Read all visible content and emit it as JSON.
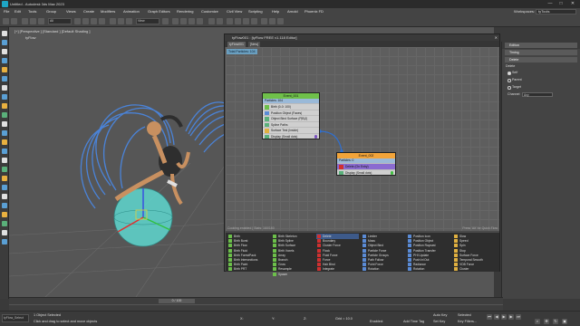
{
  "window": {
    "title": "Untitled - Autodesk 3ds Max 2023",
    "controls": [
      "—",
      "□",
      "✕"
    ]
  },
  "menu": {
    "items": [
      "File",
      "Edit",
      "Tools",
      "Group",
      "Views",
      "Create",
      "Modifiers",
      "Animation",
      "Graph Editors",
      "Rendering",
      "Customize",
      "Civil View",
      "Scripting",
      "Help",
      "Arnold",
      "Phoenix FD"
    ],
    "workspace_label": "Workspaces:",
    "workspace_value": "tyTools"
  },
  "toolbar": {
    "selection_set": "All",
    "view_select": "View"
  },
  "viewport": {
    "label": "[+] [Perspective ] [Standard ] [Default Shading ]",
    "sub_label": "tyFlow"
  },
  "editor": {
    "title": "tyFlow001 : [tyFlow FREE v1.118 Editor]",
    "tabs": [
      "tyFlow001",
      "[New]"
    ],
    "total_particles": "Total Particles: 104",
    "status_left": "Cooking enabled | Stats: 160/160",
    "status_right": "Press 'Alt' for Quick Flow",
    "event1": {
      "name": "Event_001",
      "particles": "Particles: 104",
      "operators": [
        {
          "label": "Birth (0-0: 100)",
          "icon_color": "#6cc04a"
        },
        {
          "label": "Position Object (Faces)",
          "icon_color": "#5a8bd6"
        },
        {
          "label": "Object Bind Surface (P|B|J)",
          "icon_color": "#5ab07a"
        },
        {
          "label": "Spline Paths",
          "icon_color": "#5ab07a"
        },
        {
          "label": "Surface Test (Inside)",
          "icon_color": "#e0b040"
        },
        {
          "label": "Display (Small dots)",
          "icon_color": "#5ab07a"
        }
      ]
    },
    "event2": {
      "name": "Event_002",
      "particles": "Particles: 0",
      "operators": [
        {
          "label": "Delete (On Entry)",
          "icon_color": "#d03030"
        },
        {
          "label": "Display (Small dots)",
          "icon_color": "#5ab07a"
        }
      ]
    },
    "operator_list": {
      "col1": [
        "Birth",
        "Birth Burst",
        "Birth Flow",
        "Birth Fluid",
        "Birth ForestPack",
        "Birth Intersections",
        "Birth Paint",
        "Birth PRT"
      ],
      "col2": [
        "Birth Skeleton",
        "Birth Spline",
        "Birth Surface",
        "Birth Voxels",
        "Array",
        "Branch",
        "Grow",
        "Resample",
        "Spawn"
      ],
      "col3": [
        "Delete",
        "Boundary",
        "Cluster Force",
        "Flock",
        "Fluid Force",
        "Force",
        "Hair Bind",
        "Integrate"
      ],
      "col4": [
        "Limiter",
        "Mass",
        "Object Bind",
        "Particle Force",
        "Particle Groups",
        "Path Follow",
        "Point Force",
        "Rotation"
      ],
      "col5": [
        "Position Icon",
        "Position Object",
        "Position Raycast",
        "Position Transfer",
        "PHI Update",
        "Push In/Out",
        "Radiance",
        "Rotation"
      ],
      "col6": [
        "Slow",
        "Speed",
        "Spin",
        "Stop",
        "Surface Force",
        "Temporal Smooth",
        "VDB Force",
        "Cluster"
      ],
      "col3_extra": [
        "Particle Bind",
        "Cluster Bind",
        "Collision",
        "Fluid Force",
        "Hair Bind",
        "Integrate",
        "Position",
        "Scale"
      ],
      "selected": "Delete"
    }
  },
  "right_panel": {
    "rollouts": [
      "Edition",
      "Timing",
      "Delete"
    ],
    "delete_label": "Delete",
    "radios": [
      "Self",
      "Parent",
      "Target"
    ],
    "channel_label": "Channel",
    "channel_value": "Any"
  },
  "timeline": {
    "slider": "0 / 100"
  },
  "status": {
    "selection": "1 Object Selected",
    "hint": "Click and drag to select and move objects",
    "maxscript": "tyFlow_Select",
    "x_label": "X:",
    "y_label": "Y:",
    "z_label": "Z:",
    "grid": "Grid = 10.0",
    "enabled": "Enabled:",
    "add_time_tag": "Add Time Tag",
    "auto_key": "Auto Key",
    "selected": "Selected",
    "set_key": "Set Key",
    "key_filters": "Key Filters..."
  }
}
